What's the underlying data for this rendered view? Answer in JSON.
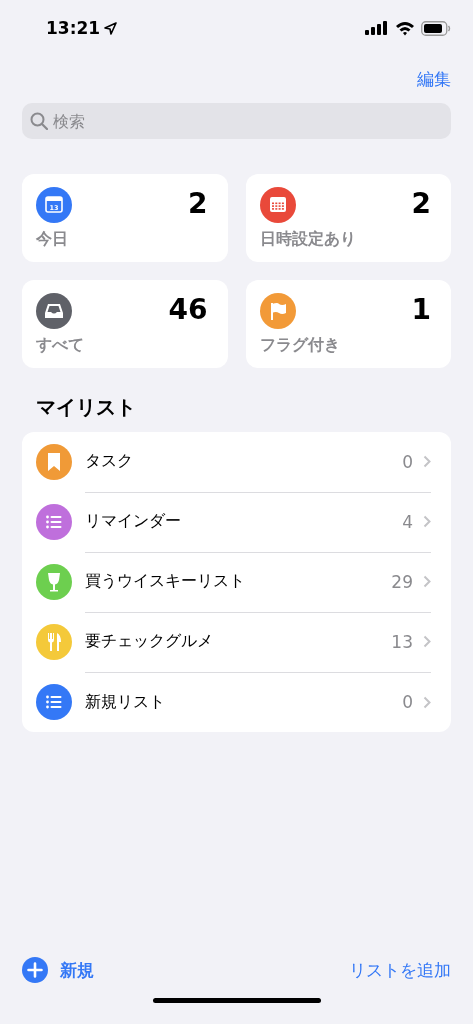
{
  "status_bar": {
    "time": "13:21"
  },
  "nav": {
    "edit": "編集"
  },
  "search": {
    "placeholder": "検索"
  },
  "smart_lists": [
    {
      "kind": "calendar",
      "label": "今日",
      "count": "2",
      "color": "#3478f6",
      "day": "13"
    },
    {
      "kind": "calendar-grid",
      "label": "日時設定あり",
      "count": "2",
      "color": "#e9493a"
    },
    {
      "kind": "tray",
      "label": "すべて",
      "count": "46",
      "color": "#5f6168"
    },
    {
      "kind": "flag",
      "label": "フラグ付き",
      "count": "1",
      "color": "#f29a38"
    }
  ],
  "my_lists": {
    "title": "マイリスト",
    "items": [
      {
        "kind": "bookmark",
        "name": "タスク",
        "count": "0",
        "color": "#f09a37"
      },
      {
        "kind": "list",
        "name": "リマインダー",
        "count": "4",
        "color": "#bf6fdc"
      },
      {
        "kind": "glass",
        "name": "買うウイスキーリスト",
        "count": "29",
        "color": "#6dcf4f"
      },
      {
        "kind": "cutlery",
        "name": "要チェックグルメ",
        "count": "13",
        "color": "#f4c93a"
      },
      {
        "kind": "list",
        "name": "新規リスト",
        "count": "0",
        "color": "#3478f6"
      }
    ]
  },
  "toolbar": {
    "new": "新規",
    "add_list": "リストを追加"
  }
}
